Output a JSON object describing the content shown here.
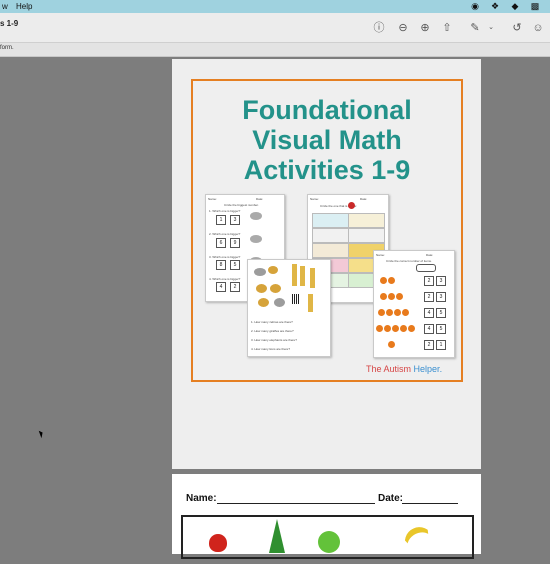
{
  "menubar": {
    "apple": "⌘",
    "menu_help": "Help"
  },
  "window": {
    "title": "s 1-9"
  },
  "subbar": {
    "text": "form."
  },
  "cover": {
    "title_line1": "Foundational",
    "title_line2": "Visual Math",
    "title_line3": "Activities 1-9",
    "brand_a": "The Autism",
    "brand_b": "Helper."
  },
  "ws1": {
    "name": "Name:",
    "date": "Date:",
    "heading": "Circle the biggest number.",
    "q1": "1. Which one is bigger?",
    "q2": "2. Which one is bigger?",
    "q3": "3. Which one is bigger?",
    "q4": "4. Which one is bigger?",
    "n1": "1",
    "n2": "3",
    "n3": "6",
    "n4": "9",
    "n5": "8",
    "n6": "5",
    "n7": "4",
    "n8": "2"
  },
  "ws2": {
    "name": "Name:",
    "date": "Date:",
    "heading": "Circle the one that is bigger."
  },
  "ws3": {
    "q1": "1. How many zebras are there?",
    "q2": "2. How many giraffes are there?",
    "q3": "3. How many elephants are there?",
    "q4": "4. How many lions are there?"
  },
  "ws4": {
    "name": "Name:",
    "date": "Date:",
    "heading": "Circle the correct number of items.",
    "r1a": "2",
    "r1b": "3",
    "r2a": "2",
    "r2b": "3",
    "r3a": "4",
    "r3b": "5",
    "r4a": "4",
    "r4b": "5",
    "r5a": "2",
    "r5b": "1"
  },
  "page2": {
    "name_label": "Name:",
    "date_label": "Date:"
  },
  "colors": {
    "menubar": "#9fd2df",
    "accent_orange": "#e57f22",
    "title_teal": "#23928a"
  }
}
